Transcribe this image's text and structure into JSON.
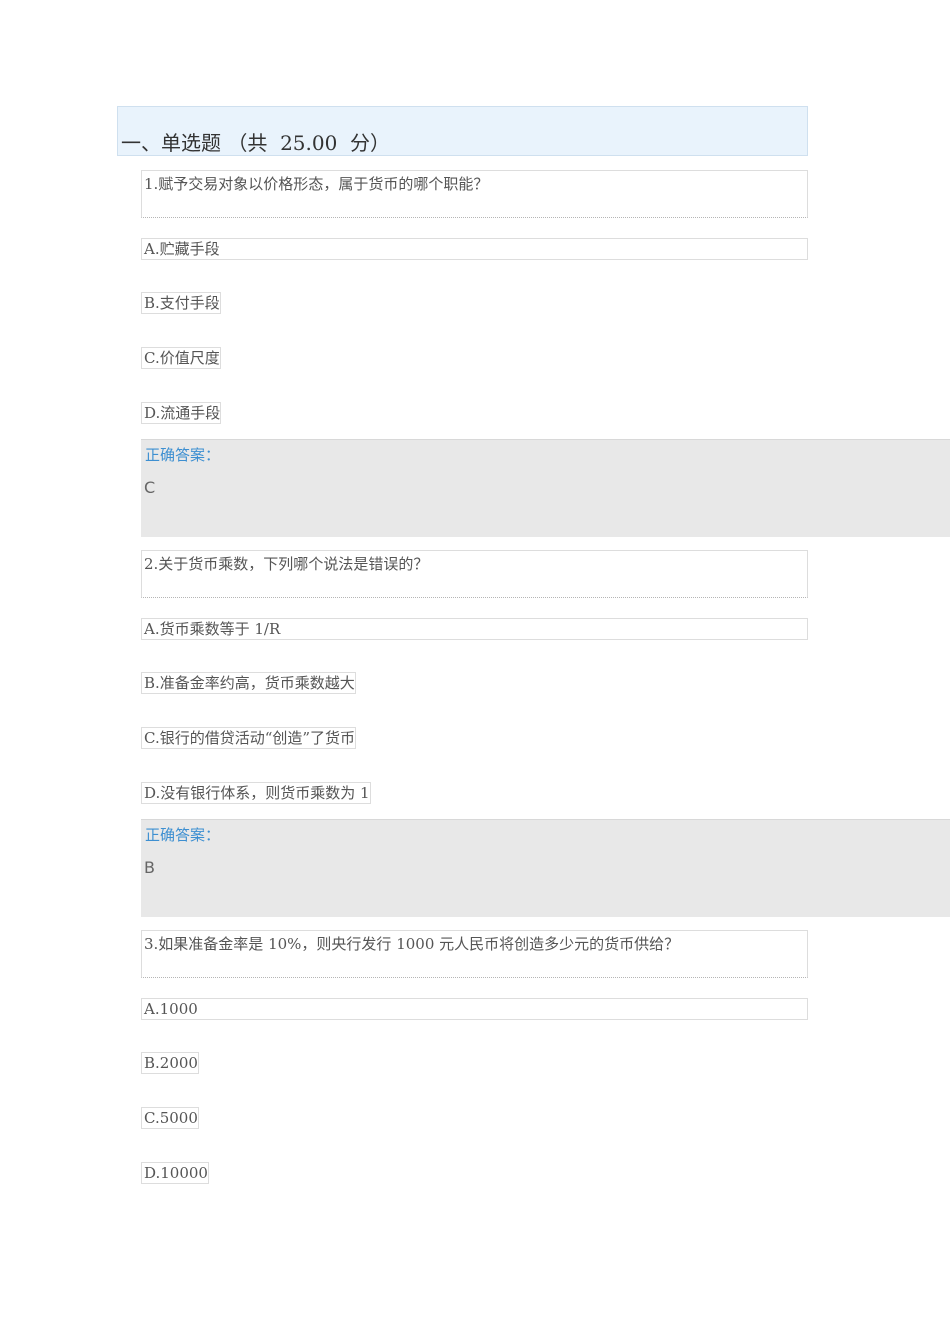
{
  "section": {
    "title": "一、单选题 （共  25.00  分）"
  },
  "questions": [
    {
      "text": "1.赋予交易对象以价格形态，属于货币的哪个职能？",
      "options": [
        "A.贮藏手段",
        "B.支付手段",
        "C.价值尺度",
        "D.流通手段"
      ],
      "answer_label": "正确答案：",
      "answer": "C"
    },
    {
      "text": "2.关于货币乘数，下列哪个说法是错误的？",
      "options": [
        "A.货币乘数等于 1/R",
        "B.准备金率约高，货币乘数越大",
        "C.银行的借贷活动“创造”了货币",
        "D.没有银行体系，则货币乘数为 1"
      ],
      "answer_label": "正确答案：",
      "answer": "B"
    },
    {
      "text": "3.如果准备金率是 10%，则央行发行 1000 元人民币将创造多少元的货币供给？",
      "options": [
        "A.1000",
        "B.2000",
        "C.5000",
        "D.10000"
      ]
    }
  ]
}
